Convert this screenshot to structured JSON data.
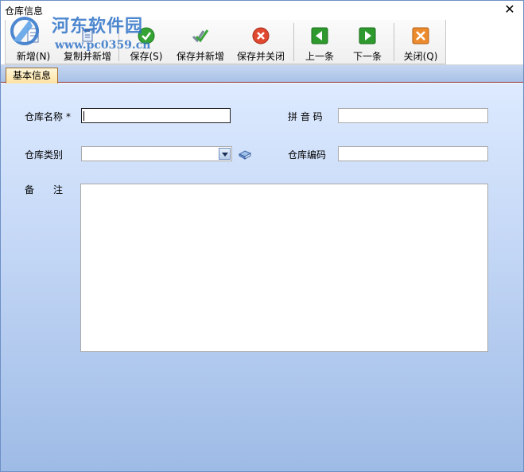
{
  "window": {
    "title": "仓库信息",
    "close_glyph": "✕"
  },
  "watermark": {
    "text": "河东软件园",
    "url": "www.pc0359.cn"
  },
  "toolbar": {
    "new": "新增(N)",
    "copy_new": "复制并新增",
    "save": "保存(S)",
    "save_new": "保存并新增",
    "save_close": "保存并关闭",
    "prev": "上一条",
    "next": "下一条",
    "close": "关闭(Q)"
  },
  "tabs": [
    {
      "label": "基本信息",
      "active": true
    }
  ],
  "form": {
    "name_label": "仓库名称",
    "required_mark": "*",
    "name_value": "",
    "pinyin_label": "拼 音 码",
    "pinyin_value": "",
    "category_label": "仓库类别",
    "category_value": "",
    "code_label": "仓库编码",
    "code_value": "",
    "remark_label_1": "备",
    "remark_label_2": "注",
    "remark_value": ""
  },
  "colors": {
    "accent_green": "#2e9a2e",
    "accent_red": "#d9452e",
    "accent_orange": "#e8862a",
    "border_blue": "#6d8fc5"
  }
}
